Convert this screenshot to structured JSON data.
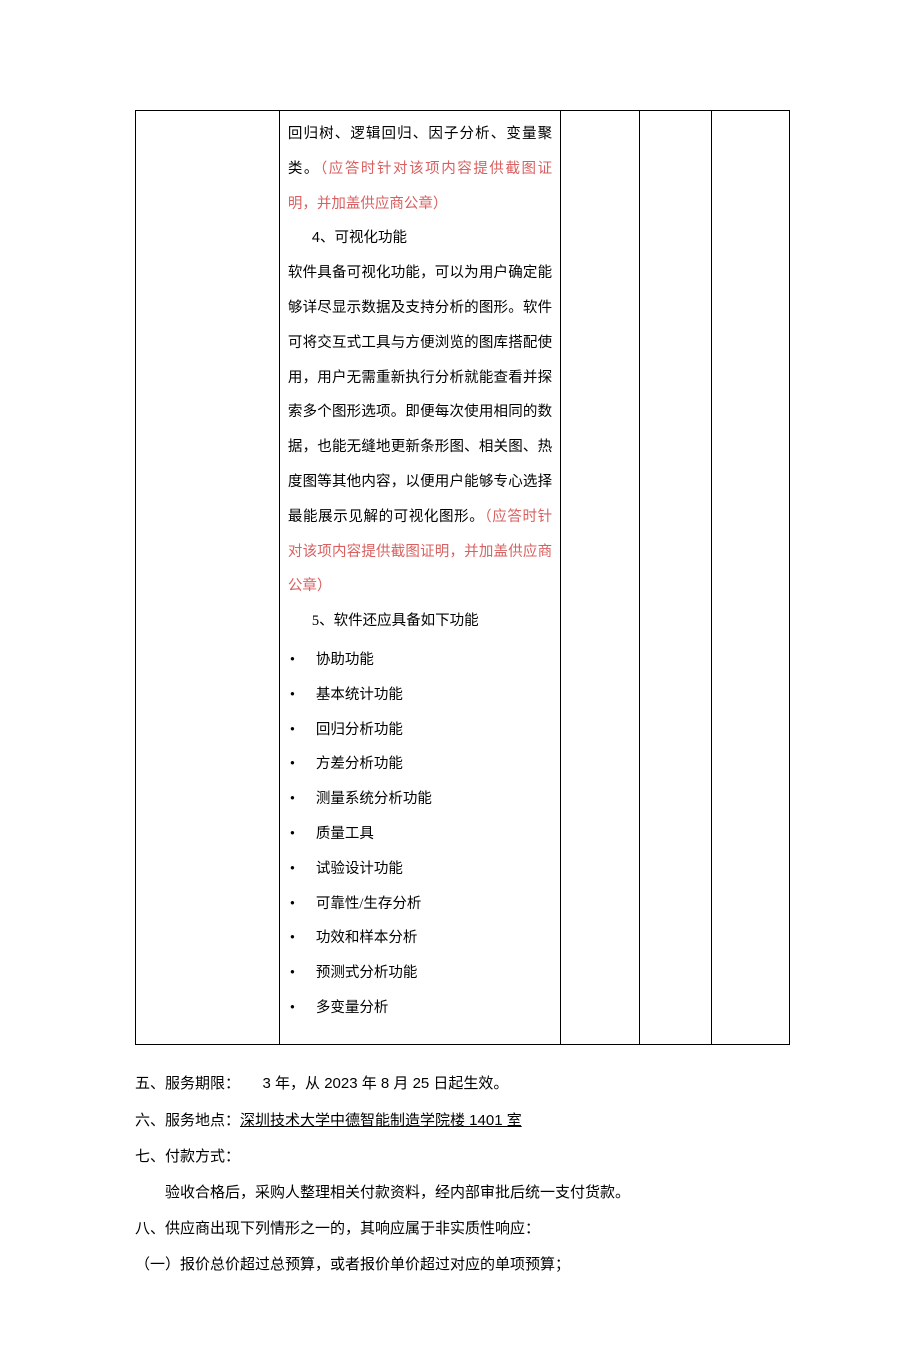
{
  "table": {
    "line1": "回归树、逻辑回归、因子分析、变量聚类。",
    "note1": "（应答时针对该项内容提供截图证明，并加盖供应商公章）",
    "sec4_title": "4、可视化功能",
    "sec4_body_a": "软件具备可视化功能，可以为用户确定能够详尽显示数据及支持分析的图形。软件可将交互式工具与方便浏览的图库搭配使用，用户无需重新执行分析就能查看并探索多个图形选项。即便每次使用相同的数据，也能无缝地更新条形图、相关图、热度图等其他内容，以便用户能够专心选择最能展示见解的可视化图形。",
    "note2": "（应答时针对该项内容提供截图证明，并加盖供应商公章）",
    "sec5_title": "5、软件还应具备如下功能",
    "bullets": [
      "协助功能",
      "基本统计功能",
      "回归分析功能",
      "方差分析功能",
      "测量系统分析功能",
      "质量工具",
      "试验设计功能",
      "可靠性/生存分析",
      "功效和样本分析",
      "预测式分析功能",
      "多变量分析"
    ]
  },
  "after": {
    "five_label": "五、服务期限：",
    "five_value_a": "3 年，从 2023 年 8 月 25 日起生效。",
    "six_label": "六、服务地点：",
    "six_value": "深圳技术大学中德智能制造学院楼 1401 室",
    "seven_label": "七、付款方式：",
    "seven_body": "验收合格后，采购人整理相关付款资料，经内部审批后统一支付货款。",
    "eight": "八、供应商出现下列情形之一的，其响应属于非实质性响应：",
    "eight_1": "（一）报价总价超过总预算，或者报价单价超过对应的单项预算；"
  }
}
